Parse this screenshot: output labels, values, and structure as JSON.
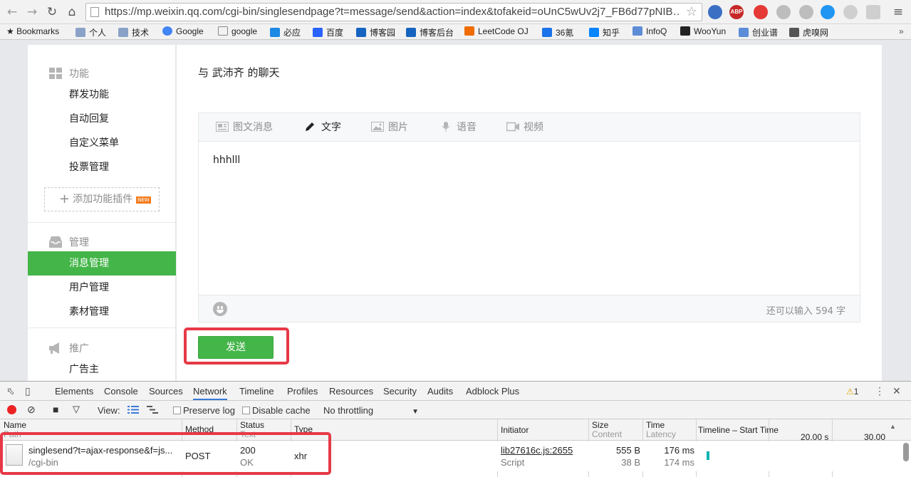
{
  "browser": {
    "url": "https://mp.weixin.qq.com/cgi-bin/singlesendpage?t=message/send&action=index&tofakeid=oUnC5wUv2j7_FB6d77pNIB…",
    "abp_label": "ABP",
    "bookmarks": [
      "Bookmarks",
      "个人",
      "技术",
      "Google",
      "google",
      "必应",
      "百度",
      "博客园",
      "博客后台",
      "LeetCode OJ",
      "36氪",
      "知乎",
      "InfoQ",
      "WooYun",
      "创业谱",
      "虎嗅网"
    ]
  },
  "sidebar": {
    "sections": [
      {
        "label": "功能",
        "items": [
          "群发功能",
          "自动回复",
          "自定义菜单",
          "投票管理"
        ]
      },
      {
        "label": "管理",
        "items": [
          "消息管理",
          "用户管理",
          "素材管理"
        ]
      },
      {
        "label": "推广",
        "items": [
          "广告主"
        ]
      }
    ],
    "plugin_button": "添加功能插件",
    "new_badge": "NEW",
    "active_item": "消息管理"
  },
  "main": {
    "chat_title": "与 武沛齐 的聊天",
    "tabs": [
      {
        "label": "图文消息",
        "icon": "news-icon"
      },
      {
        "label": "文字",
        "icon": "pencil-icon"
      },
      {
        "label": "图片",
        "icon": "image-icon"
      },
      {
        "label": "语音",
        "icon": "microphone-icon"
      },
      {
        "label": "视频",
        "icon": "video-icon"
      }
    ],
    "active_tab": "文字",
    "message_text": "hhhlll",
    "counter_text": "还可以输入 594 字",
    "send_label": "发送"
  },
  "devtools": {
    "tabs": [
      "Elements",
      "Console",
      "Sources",
      "Network",
      "Timeline",
      "Profiles",
      "Resources",
      "Security",
      "Audits",
      "Adblock Plus"
    ],
    "active_tab": "Network",
    "warning_count": "1",
    "toolbar": {
      "view_label": "View:",
      "preserve_log": "Preserve log",
      "disable_cache": "Disable cache",
      "throttling": "No throttling"
    },
    "columns": {
      "name": "Name",
      "path": "Path",
      "method": "Method",
      "status": "Status",
      "text": "Text",
      "type": "Type",
      "initiator": "Initiator",
      "size": "Size",
      "content": "Content",
      "time": "Time",
      "latency": "Latency",
      "timeline": "Timeline – Start Time",
      "tick1": "20.00 s",
      "tick2": "30.00"
    },
    "request": {
      "name": "singlesend?t=ajax-response&f=js...",
      "path": "/cgi-bin",
      "method": "POST",
      "status": "200",
      "status_text": "OK",
      "type": "xhr",
      "initiator": "lib27616c.js:2655",
      "initiator_type": "Script",
      "size": "555 B",
      "content": "38 B",
      "time": "176 ms",
      "latency": "174 ms"
    }
  },
  "colors": {
    "accent_green": "#44b549",
    "highlight_red": "#e63946"
  }
}
